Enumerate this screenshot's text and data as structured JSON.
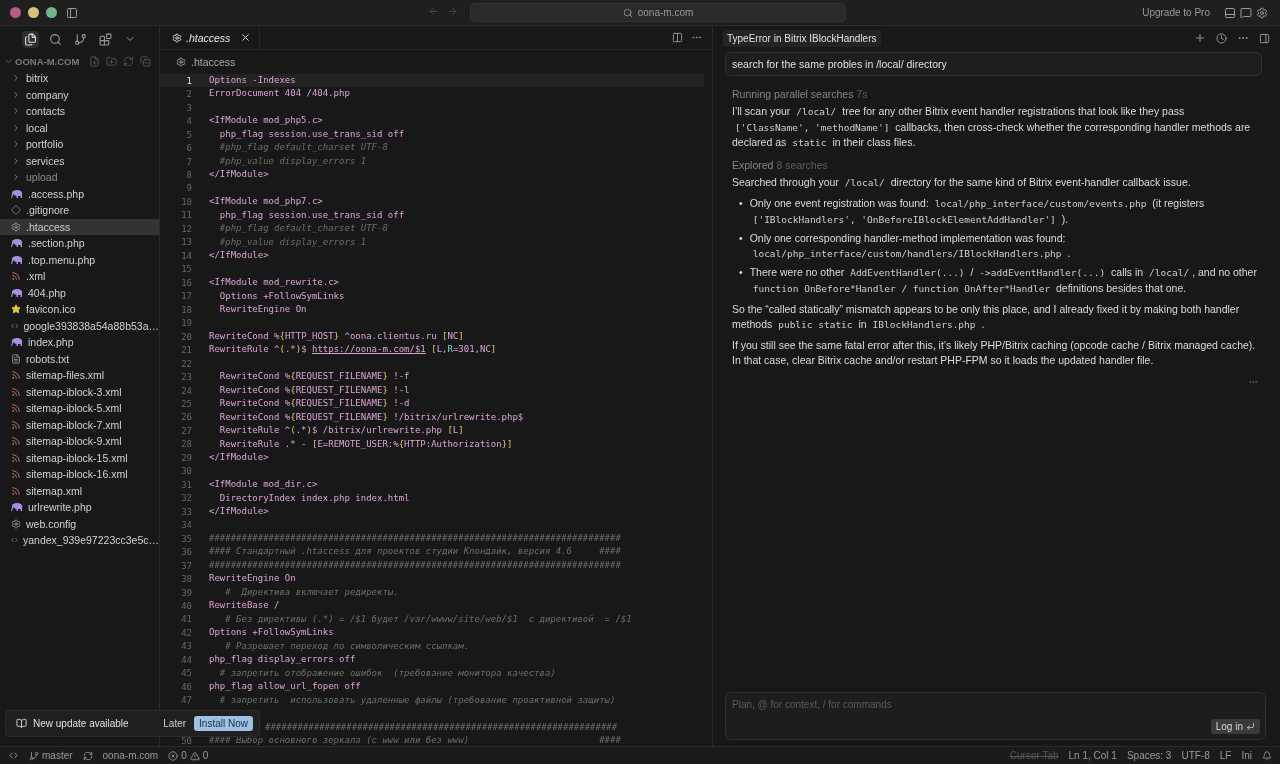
{
  "window": {
    "address": "oona-m.com",
    "upgrade": "Upgrade to Pro"
  },
  "activity_bar": [
    {
      "kind": "files",
      "selected": true
    },
    {
      "kind": "search",
      "selected": false
    },
    {
      "kind": "source-control",
      "selected": false
    },
    {
      "kind": "extensions",
      "selected": false
    },
    {
      "kind": "more",
      "selected": false
    }
  ],
  "explorer": {
    "title": "OONA-M.COM",
    "expanded": true,
    "items": [
      {
        "name": "bitrix",
        "kind": "folder",
        "expanded": false,
        "selected": false,
        "dimmed": false
      },
      {
        "name": "company",
        "kind": "folder",
        "expanded": false,
        "selected": false,
        "dimmed": false
      },
      {
        "name": "contacts",
        "kind": "folder",
        "expanded": false,
        "selected": false,
        "dimmed": false
      },
      {
        "name": "local",
        "kind": "folder",
        "expanded": false,
        "selected": false,
        "dimmed": false
      },
      {
        "name": "portfolio",
        "kind": "folder",
        "expanded": false,
        "selected": false,
        "dimmed": false
      },
      {
        "name": "services",
        "kind": "folder",
        "expanded": false,
        "selected": false,
        "dimmed": false
      },
      {
        "name": "upload",
        "kind": "folder",
        "expanded": false,
        "selected": false,
        "dimmed": true
      },
      {
        "name": ".access.php",
        "kind": "php",
        "selected": false,
        "dimmed": false
      },
      {
        "name": ".gitignore",
        "kind": "git",
        "selected": false,
        "dimmed": false
      },
      {
        "name": ".htaccess",
        "kind": "config",
        "selected": true,
        "dimmed": false
      },
      {
        "name": ".section.php",
        "kind": "php",
        "selected": false,
        "dimmed": false
      },
      {
        "name": ".top.menu.php",
        "kind": "php",
        "selected": false,
        "dimmed": false
      },
      {
        "name": ".xml",
        "kind": "feed",
        "selected": false,
        "dimmed": false
      },
      {
        "name": "404.php",
        "kind": "php",
        "selected": false,
        "dimmed": false
      },
      {
        "name": "favicon.ico",
        "kind": "star",
        "selected": false,
        "dimmed": false
      },
      {
        "name": "google393838a54a88b53a…",
        "kind": "markup",
        "selected": false,
        "dimmed": false
      },
      {
        "name": "index.php",
        "kind": "php",
        "selected": false,
        "dimmed": false
      },
      {
        "name": "robots.txt",
        "kind": "text",
        "selected": false,
        "dimmed": false
      },
      {
        "name": "sitemap-files.xml",
        "kind": "feed",
        "selected": false,
        "dimmed": false
      },
      {
        "name": "sitemap-iblock-3.xml",
        "kind": "feed",
        "selected": false,
        "dimmed": false
      },
      {
        "name": "sitemap-iblock-5.xml",
        "kind": "feed",
        "selected": false,
        "dimmed": false
      },
      {
        "name": "sitemap-iblock-7.xml",
        "kind": "feed",
        "selected": false,
        "dimmed": false
      },
      {
        "name": "sitemap-iblock-9.xml",
        "kind": "feed",
        "selected": false,
        "dimmed": false
      },
      {
        "name": "sitemap-iblock-15.xml",
        "kind": "feed",
        "selected": false,
        "dimmed": false
      },
      {
        "name": "sitemap-iblock-16.xml",
        "kind": "feed",
        "selected": false,
        "dimmed": false
      },
      {
        "name": "sitemap.xml",
        "kind": "feed",
        "selected": false,
        "dimmed": false
      },
      {
        "name": "urlrewrite.php",
        "kind": "php",
        "selected": false,
        "dimmed": false
      },
      {
        "name": "web.config",
        "kind": "config",
        "selected": false,
        "dimmed": false
      },
      {
        "name": "yandex_939e97223cc3e5c…",
        "kind": "markup",
        "selected": false,
        "dimmed": false
      }
    ]
  },
  "editor": {
    "tab": ".htaccess",
    "breadcrumb": ".htaccess",
    "lines": [
      {
        "number": "1",
        "text": "Options -Indexes",
        "kind": "code",
        "current": true
      },
      {
        "number": "2",
        "text": "ErrorDocument 404 /404.php",
        "kind": "code",
        "current": false
      },
      {
        "number": "3",
        "current": false
      },
      {
        "number": "4",
        "text": "<IfModule mod_php5.c>",
        "kind": "code",
        "current": false
      },
      {
        "number": "5",
        "text": "  php_flag session.use_trans_sid off",
        "kind": "code",
        "current": false
      },
      {
        "number": "6",
        "text": "  #php_flag default_charset UTF-8",
        "kind": "comment",
        "current": false
      },
      {
        "number": "7",
        "text": "  #php_value display_errors 1",
        "kind": "comment",
        "current": false
      },
      {
        "number": "8",
        "text": "</IfModule>",
        "kind": "code",
        "current": false
      },
      {
        "number": "9",
        "current": false
      },
      {
        "number": "10",
        "text": "<IfModule mod_php7.c>",
        "kind": "code",
        "current": false
      },
      {
        "number": "11",
        "text": "  php_flag session.use_trans_sid off",
        "kind": "code",
        "current": false
      },
      {
        "number": "12",
        "text": "  #php_flag default_charset UTF-8",
        "kind": "comment",
        "current": false
      },
      {
        "number": "13",
        "text": "  #php_value display_errors 1",
        "kind": "comment",
        "current": false
      },
      {
        "number": "14",
        "text": "</IfModule>",
        "kind": "code",
        "current": false
      },
      {
        "number": "15",
        "current": false
      },
      {
        "number": "16",
        "text": "<IfModule mod_rewrite.c>",
        "kind": "code",
        "current": false
      },
      {
        "number": "17",
        "text": "  Options +FollowSymLinks",
        "kind": "code",
        "current": false
      },
      {
        "number": "18",
        "text": "  RewriteEngine On",
        "kind": "code",
        "current": false
      },
      {
        "number": "19",
        "current": false
      },
      {
        "number": "20",
        "current": false,
        "segments": [
          {
            "text": "RewriteCond %",
            "kind": "code"
          },
          {
            "text": "{",
            "kind": "punct"
          },
          {
            "text": "HTTP_HOST",
            "kind": "code"
          },
          {
            "text": "}",
            "kind": "punct"
          },
          {
            "text": " ^oona.clientus.ru ",
            "kind": "code"
          },
          {
            "text": "[",
            "kind": "punct"
          },
          {
            "text": "NC",
            "kind": "code"
          },
          {
            "text": "]",
            "kind": "punct"
          }
        ]
      },
      {
        "number": "21",
        "current": false,
        "segments": [
          {
            "text": "RewriteRule ^",
            "kind": "code"
          },
          {
            "text": "(",
            "kind": "punct"
          },
          {
            "text": ".*",
            "kind": "code"
          },
          {
            "text": ")",
            "kind": "punct"
          },
          {
            "text": "$ ",
            "kind": "code"
          },
          {
            "text": "https://oona-m.com/$1",
            "kind": "link"
          },
          {
            "text": " [",
            "kind": "punct"
          },
          {
            "text": "L,",
            "kind": "code"
          },
          {
            "text": "R",
            "kind": "flag"
          },
          {
            "text": "=301,NC",
            "kind": "code"
          },
          {
            "text": "]",
            "kind": "punct"
          }
        ]
      },
      {
        "number": "22",
        "current": false
      },
      {
        "number": "23",
        "current": false,
        "segments": [
          {
            "text": "  RewriteCond %",
            "kind": "code"
          },
          {
            "text": "{",
            "kind": "punct"
          },
          {
            "text": "REQUEST_FILENAME",
            "kind": "code"
          },
          {
            "text": "}",
            "kind": "punct"
          },
          {
            "text": " !-f",
            "kind": "code"
          }
        ]
      },
      {
        "number": "24",
        "current": false,
        "segments": [
          {
            "text": "  RewriteCond %",
            "kind": "code"
          },
          {
            "text": "{",
            "kind": "punct"
          },
          {
            "text": "REQUEST_FILENAME",
            "kind": "code"
          },
          {
            "text": "}",
            "kind": "punct"
          },
          {
            "text": " !-l",
            "kind": "code"
          }
        ]
      },
      {
        "number": "25",
        "current": false,
        "segments": [
          {
            "text": "  RewriteCond %",
            "kind": "code"
          },
          {
            "text": "{",
            "kind": "punct"
          },
          {
            "text": "REQUEST_FILENAME",
            "kind": "code"
          },
          {
            "text": "}",
            "kind": "punct"
          },
          {
            "text": " !-d",
            "kind": "code"
          }
        ]
      },
      {
        "number": "26",
        "current": false,
        "segments": [
          {
            "text": "  RewriteCond %",
            "kind": "code"
          },
          {
            "text": "{",
            "kind": "punct"
          },
          {
            "text": "REQUEST_FILENAME",
            "kind": "code"
          },
          {
            "text": "}",
            "kind": "punct"
          },
          {
            "text": " !/bitrix/urlrewrite.php$",
            "kind": "code"
          }
        ]
      },
      {
        "number": "27",
        "current": false,
        "segments": [
          {
            "text": "  RewriteRule ^",
            "kind": "code"
          },
          {
            "text": "(",
            "kind": "punct"
          },
          {
            "text": ".*",
            "kind": "code"
          },
          {
            "text": ")",
            "kind": "punct"
          },
          {
            "text": "$ /bitrix/urlrewrite.php ",
            "kind": "code"
          },
          {
            "text": "[",
            "kind": "punct"
          },
          {
            "text": "L",
            "kind": "code"
          },
          {
            "text": "]",
            "kind": "punct"
          }
        ]
      },
      {
        "number": "28",
        "current": false,
        "segments": [
          {
            "text": "  RewriteRule .* - ",
            "kind": "code"
          },
          {
            "text": "[",
            "kind": "punct"
          },
          {
            "text": "E=REMOTE_USER:%",
            "kind": "code"
          },
          {
            "text": "{",
            "kind": "punct"
          },
          {
            "text": "HTTP:Authorization",
            "kind": "code"
          },
          {
            "text": "}",
            "kind": "punct"
          },
          {
            "text": "]",
            "kind": "punct"
          }
        ]
      },
      {
        "number": "29",
        "text": "</IfModule>",
        "kind": "code",
        "current": false
      },
      {
        "number": "30",
        "current": false
      },
      {
        "number": "31",
        "text": "<IfModule mod_dir.c>",
        "kind": "code",
        "current": false
      },
      {
        "number": "32",
        "text": "  DirectoryIndex index.php index.html",
        "kind": "code",
        "current": false
      },
      {
        "number": "33",
        "text": "</IfModule>",
        "kind": "code",
        "current": false
      },
      {
        "number": "34",
        "current": false
      },
      {
        "number": "35",
        "text": "############################################################################",
        "kind": "comment",
        "current": false
      },
      {
        "number": "36",
        "text": "#### Стандартный .htaccess для проектов студии Клондайк, версия 4.6     ####",
        "kind": "comment",
        "current": false
      },
      {
        "number": "37",
        "text": "############################################################################",
        "kind": "comment",
        "current": false
      },
      {
        "number": "38",
        "text": "RewriteEngine On",
        "kind": "code",
        "current": false
      },
      {
        "number": "39",
        "text": "   #  Директива включает редиректы.",
        "kind": "comment",
        "current": false
      },
      {
        "number": "40",
        "text": "RewriteBase /",
        "kind": "code",
        "current": false
      },
      {
        "number": "41",
        "text": "   # Без директивы (.*) = /$1 будет /var/wwww/site/web/$1  с директивой  = /$1",
        "kind": "comment",
        "current": false
      },
      {
        "number": "42",
        "text": "Options +FollowSymLinks",
        "kind": "code",
        "current": false
      },
      {
        "number": "43",
        "text": "   # Разрешает переход по символическим ссылкам.",
        "kind": "comment",
        "current": false
      },
      {
        "number": "44",
        "text": "php_flag display_errors off",
        "kind": "code",
        "current": false
      },
      {
        "number": "45",
        "text": "  # запретить отображение ошибок  (требование монитора качества)",
        "kind": "comment",
        "current": false
      },
      {
        "number": "46",
        "text": "php_flag allow_url_fopen off",
        "kind": "code",
        "current": false
      },
      {
        "number": "47",
        "text": "  # запретить  использовать удаленные файлы (требование проактивной защиты)",
        "kind": "comment",
        "current": false
      },
      {
        "after_gap": true,
        "covered": true,
        "text": "#################################################################",
        "kind": "comment"
      },
      {
        "number": "50",
        "text": "#### Выбор основного зеркала (с www или без www)                        ####",
        "kind": "comment",
        "current": false
      }
    ]
  },
  "notification": {
    "message": "New update available",
    "later": "Later",
    "install": "Install Now"
  },
  "chat": {
    "title": "TypeError in Bitrix IBlockHandlers",
    "prompt": "search for the same probles in /local/ directory",
    "blocks": [
      {
        "kind": "status",
        "label": "Running parallel searches",
        "detail": "7s"
      },
      {
        "kind": "paragraph",
        "segments": [
          {
            "text": "I’ll scan your ",
            "kind": "text"
          },
          {
            "text": "/local/",
            "kind": "code"
          },
          {
            "text": " tree for any other Bitrix event handler registrations that look like they pass ",
            "kind": "text"
          },
          {
            "text": "['ClassName', 'methodName']",
            "kind": "code"
          },
          {
            "text": " callbacks, then cross-check whether the corresponding handler methods are declared as ",
            "kind": "text"
          },
          {
            "text": "static",
            "kind": "code"
          },
          {
            "text": " in their class files.",
            "kind": "text"
          }
        ]
      },
      {
        "kind": "status",
        "label": "Explored",
        "detail": "8 searches"
      },
      {
        "kind": "paragraph",
        "segments": [
          {
            "text": "Searched through your ",
            "kind": "text"
          },
          {
            "text": "/local/",
            "kind": "code"
          },
          {
            "text": " directory for the same kind of Bitrix event-handler callback issue.",
            "kind": "text"
          }
        ]
      },
      {
        "kind": "bullets",
        "items": [
          {
            "marker": "•",
            "segments": [
              {
                "text": "Only one event registration was found: ",
                "kind": "text"
              },
              {
                "text": "local/php_interface/custom/events.php",
                "kind": "code"
              },
              {
                "text": " (it registers ",
                "kind": "text"
              },
              {
                "text": "['IBlockHandlers', 'OnBeforeIBlockElementAddHandler']",
                "kind": "code"
              },
              {
                "text": " ).",
                "kind": "text"
              }
            ]
          },
          {
            "marker": "•",
            "segments": [
              {
                "text": "Only one corresponding handler-method implementation was found: ",
                "kind": "text"
              },
              {
                "text": "local/php_interface/custom/handlers/IBlockHandlers.php",
                "kind": "code"
              },
              {
                "text": " .",
                "kind": "text"
              }
            ]
          },
          {
            "marker": "•",
            "segments": [
              {
                "text": "There were no other ",
                "kind": "text"
              },
              {
                "text": "AddEventHandler(...)",
                "kind": "code"
              },
              {
                "text": " / ",
                "kind": "text"
              },
              {
                "text": "->addEventHandler(...)",
                "kind": "code"
              },
              {
                "text": " calls in ",
                "kind": "text"
              },
              {
                "text": "/local/",
                "kind": "code"
              },
              {
                "text": ", and no other ",
                "kind": "text"
              },
              {
                "text": "function OnBefore*Handler / function OnAfter*Handler",
                "kind": "code"
              },
              {
                "text": " definitions besides that one.",
                "kind": "text"
              }
            ]
          }
        ]
      },
      {
        "kind": "paragraph",
        "segments": [
          {
            "text": "So the “called statically” mismatch appears to be only this place, and I already fixed it by making both handler methods ",
            "kind": "text"
          },
          {
            "text": "public static",
            "kind": "code"
          },
          {
            "text": " in ",
            "kind": "text"
          },
          {
            "text": "IBlockHandlers.php",
            "kind": "code"
          },
          {
            "text": " .",
            "kind": "text"
          }
        ]
      },
      {
        "kind": "paragraph",
        "segments": [
          {
            "text": "If you still see the same fatal error after this, it’s likely PHP/Bitrix caching (opcode cache / Bitrix managed cache). In that case, clear Bitrix cache and/or restart PHP-FPM so it loads the updated handler file.",
            "kind": "text"
          }
        ]
      }
    ],
    "input": {
      "placeholder": "Plan, @ for context, / for commands",
      "button": "Log in"
    }
  },
  "status_bar": {
    "branch": "master",
    "remote": "oona-m.com",
    "errors": "0",
    "warnings": "0",
    "items": [
      {
        "label": "Cursor Tab",
        "disabled": true
      },
      {
        "label": "Ln 1, Col 1",
        "disabled": false
      },
      {
        "label": "Spaces: 3",
        "disabled": false
      },
      {
        "label": "UTF-8",
        "disabled": false
      },
      {
        "label": "LF",
        "disabled": false
      },
      {
        "label": "Ini",
        "disabled": false
      }
    ]
  }
}
